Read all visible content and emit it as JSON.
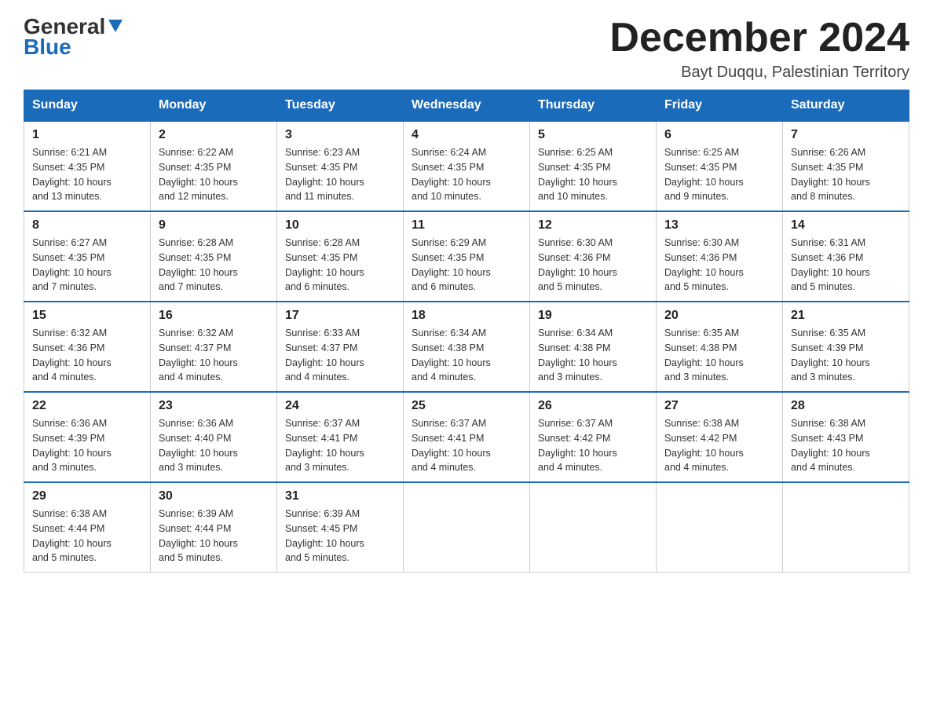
{
  "logo": {
    "general": "General",
    "blue": "Blue"
  },
  "title": {
    "month": "December 2024",
    "location": "Bayt Duqqu, Palestinian Territory"
  },
  "headers": [
    "Sunday",
    "Monday",
    "Tuesday",
    "Wednesday",
    "Thursday",
    "Friday",
    "Saturday"
  ],
  "weeks": [
    [
      {
        "day": "1",
        "sunrise": "6:21 AM",
        "sunset": "4:35 PM",
        "daylight": "10 hours and 13 minutes."
      },
      {
        "day": "2",
        "sunrise": "6:22 AM",
        "sunset": "4:35 PM",
        "daylight": "10 hours and 12 minutes."
      },
      {
        "day": "3",
        "sunrise": "6:23 AM",
        "sunset": "4:35 PM",
        "daylight": "10 hours and 11 minutes."
      },
      {
        "day": "4",
        "sunrise": "6:24 AM",
        "sunset": "4:35 PM",
        "daylight": "10 hours and 10 minutes."
      },
      {
        "day": "5",
        "sunrise": "6:25 AM",
        "sunset": "4:35 PM",
        "daylight": "10 hours and 10 minutes."
      },
      {
        "day": "6",
        "sunrise": "6:25 AM",
        "sunset": "4:35 PM",
        "daylight": "10 hours and 9 minutes."
      },
      {
        "day": "7",
        "sunrise": "6:26 AM",
        "sunset": "4:35 PM",
        "daylight": "10 hours and 8 minutes."
      }
    ],
    [
      {
        "day": "8",
        "sunrise": "6:27 AM",
        "sunset": "4:35 PM",
        "daylight": "10 hours and 7 minutes."
      },
      {
        "day": "9",
        "sunrise": "6:28 AM",
        "sunset": "4:35 PM",
        "daylight": "10 hours and 7 minutes."
      },
      {
        "day": "10",
        "sunrise": "6:28 AM",
        "sunset": "4:35 PM",
        "daylight": "10 hours and 6 minutes."
      },
      {
        "day": "11",
        "sunrise": "6:29 AM",
        "sunset": "4:35 PM",
        "daylight": "10 hours and 6 minutes."
      },
      {
        "day": "12",
        "sunrise": "6:30 AM",
        "sunset": "4:36 PM",
        "daylight": "10 hours and 5 minutes."
      },
      {
        "day": "13",
        "sunrise": "6:30 AM",
        "sunset": "4:36 PM",
        "daylight": "10 hours and 5 minutes."
      },
      {
        "day": "14",
        "sunrise": "6:31 AM",
        "sunset": "4:36 PM",
        "daylight": "10 hours and 5 minutes."
      }
    ],
    [
      {
        "day": "15",
        "sunrise": "6:32 AM",
        "sunset": "4:36 PM",
        "daylight": "10 hours and 4 minutes."
      },
      {
        "day": "16",
        "sunrise": "6:32 AM",
        "sunset": "4:37 PM",
        "daylight": "10 hours and 4 minutes."
      },
      {
        "day": "17",
        "sunrise": "6:33 AM",
        "sunset": "4:37 PM",
        "daylight": "10 hours and 4 minutes."
      },
      {
        "day": "18",
        "sunrise": "6:34 AM",
        "sunset": "4:38 PM",
        "daylight": "10 hours and 4 minutes."
      },
      {
        "day": "19",
        "sunrise": "6:34 AM",
        "sunset": "4:38 PM",
        "daylight": "10 hours and 3 minutes."
      },
      {
        "day": "20",
        "sunrise": "6:35 AM",
        "sunset": "4:38 PM",
        "daylight": "10 hours and 3 minutes."
      },
      {
        "day": "21",
        "sunrise": "6:35 AM",
        "sunset": "4:39 PM",
        "daylight": "10 hours and 3 minutes."
      }
    ],
    [
      {
        "day": "22",
        "sunrise": "6:36 AM",
        "sunset": "4:39 PM",
        "daylight": "10 hours and 3 minutes."
      },
      {
        "day": "23",
        "sunrise": "6:36 AM",
        "sunset": "4:40 PM",
        "daylight": "10 hours and 3 minutes."
      },
      {
        "day": "24",
        "sunrise": "6:37 AM",
        "sunset": "4:41 PM",
        "daylight": "10 hours and 3 minutes."
      },
      {
        "day": "25",
        "sunrise": "6:37 AM",
        "sunset": "4:41 PM",
        "daylight": "10 hours and 4 minutes."
      },
      {
        "day": "26",
        "sunrise": "6:37 AM",
        "sunset": "4:42 PM",
        "daylight": "10 hours and 4 minutes."
      },
      {
        "day": "27",
        "sunrise": "6:38 AM",
        "sunset": "4:42 PM",
        "daylight": "10 hours and 4 minutes."
      },
      {
        "day": "28",
        "sunrise": "6:38 AM",
        "sunset": "4:43 PM",
        "daylight": "10 hours and 4 minutes."
      }
    ],
    [
      {
        "day": "29",
        "sunrise": "6:38 AM",
        "sunset": "4:44 PM",
        "daylight": "10 hours and 5 minutes."
      },
      {
        "day": "30",
        "sunrise": "6:39 AM",
        "sunset": "4:44 PM",
        "daylight": "10 hours and 5 minutes."
      },
      {
        "day": "31",
        "sunrise": "6:39 AM",
        "sunset": "4:45 PM",
        "daylight": "10 hours and 5 minutes."
      },
      null,
      null,
      null,
      null
    ]
  ],
  "labels": {
    "sunrise": "Sunrise:",
    "sunset": "Sunset:",
    "daylight": "Daylight:"
  }
}
